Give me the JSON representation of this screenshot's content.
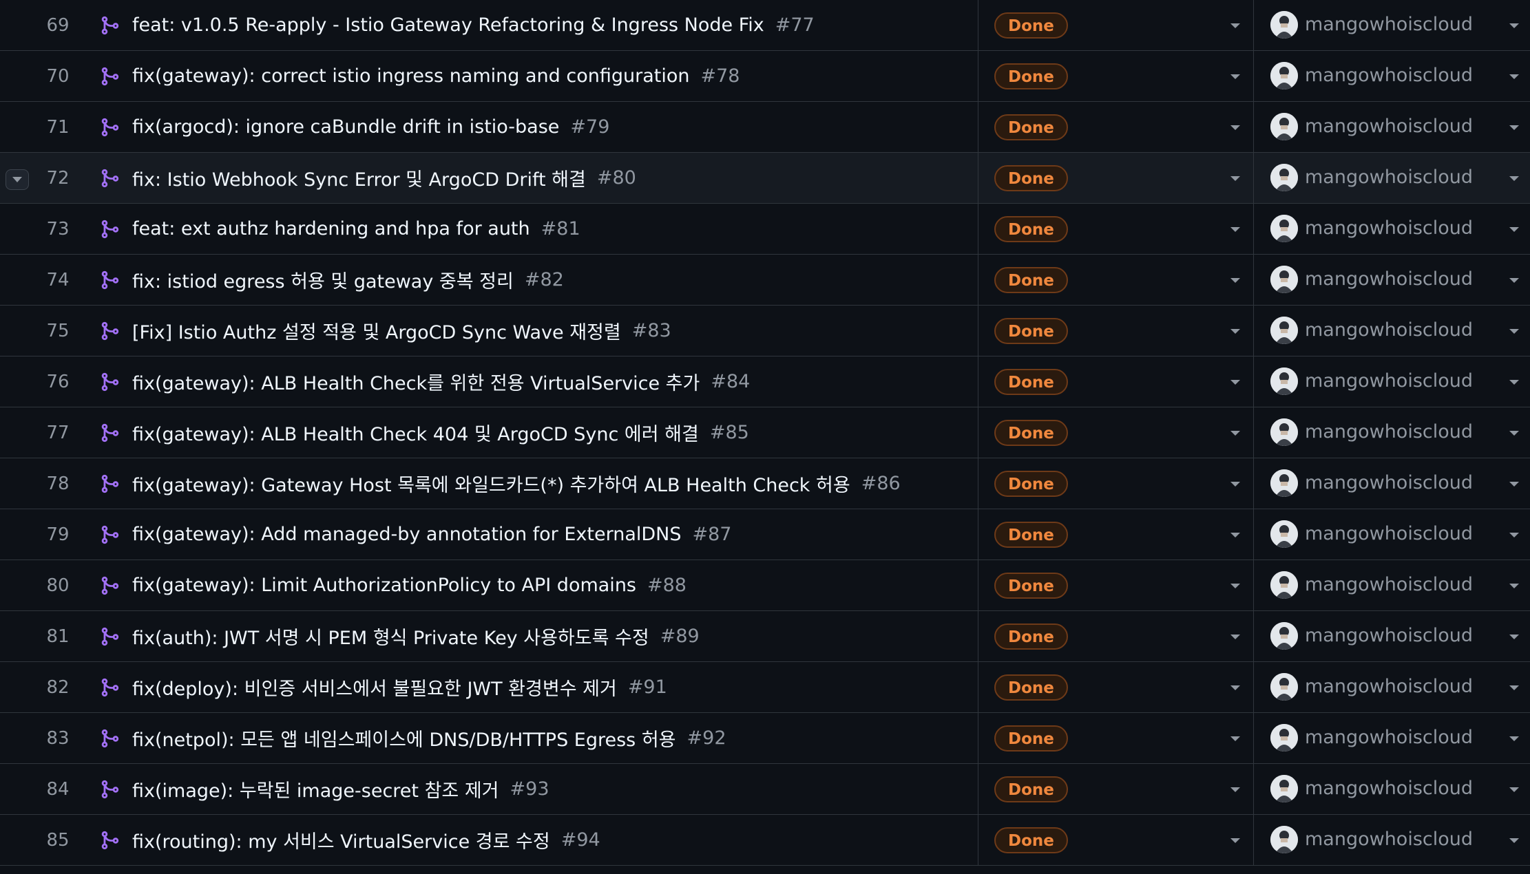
{
  "rows": [
    {
      "num": "69",
      "title": "feat: v1.0.5 Re-apply - Istio Gateway Refactoring & Ingress Node Fix",
      "pr": "#77",
      "status": "Done",
      "assignee": "mangowhoiscloud"
    },
    {
      "num": "70",
      "title": "fix(gateway): correct istio ingress naming and configuration",
      "pr": "#78",
      "status": "Done",
      "assignee": "mangowhoiscloud"
    },
    {
      "num": "71",
      "title": "fix(argocd): ignore caBundle drift in istio-base",
      "pr": "#79",
      "status": "Done",
      "assignee": "mangowhoiscloud"
    },
    {
      "num": "72",
      "title": "fix: Istio Webhook Sync Error 및 ArgoCD Drift 해결",
      "pr": "#80",
      "status": "Done",
      "assignee": "mangowhoiscloud"
    },
    {
      "num": "73",
      "title": "feat: ext authz hardening and hpa for auth",
      "pr": "#81",
      "status": "Done",
      "assignee": "mangowhoiscloud"
    },
    {
      "num": "74",
      "title": "fix: istiod egress 허용 및 gateway 중복 정리",
      "pr": "#82",
      "status": "Done",
      "assignee": "mangowhoiscloud"
    },
    {
      "num": "75",
      "title": "[Fix] Istio Authz 설정 적용 및 ArgoCD Sync Wave 재정렬",
      "pr": "#83",
      "status": "Done",
      "assignee": "mangowhoiscloud"
    },
    {
      "num": "76",
      "title": "fix(gateway): ALB Health Check를 위한 전용 VirtualService 추가",
      "pr": "#84",
      "status": "Done",
      "assignee": "mangowhoiscloud"
    },
    {
      "num": "77",
      "title": "fix(gateway): ALB Health Check 404 및 ArgoCD Sync 에러 해결",
      "pr": "#85",
      "status": "Done",
      "assignee": "mangowhoiscloud"
    },
    {
      "num": "78",
      "title": "fix(gateway): Gateway Host 목록에 와일드카드(*) 추가하여 ALB Health Check 허용",
      "pr": "#86",
      "status": "Done",
      "assignee": "mangowhoiscloud"
    },
    {
      "num": "79",
      "title": "fix(gateway): Add managed-by annotation for ExternalDNS",
      "pr": "#87",
      "status": "Done",
      "assignee": "mangowhoiscloud"
    },
    {
      "num": "80",
      "title": "fix(gateway): Limit AuthorizationPolicy to API domains",
      "pr": "#88",
      "status": "Done",
      "assignee": "mangowhoiscloud"
    },
    {
      "num": "81",
      "title": "fix(auth): JWT 서명 시 PEM 형식 Private Key 사용하도록 수정",
      "pr": "#89",
      "status": "Done",
      "assignee": "mangowhoiscloud"
    },
    {
      "num": "82",
      "title": "fix(deploy): 비인증 서비스에서 불필요한 JWT 환경변수 제거",
      "pr": "#91",
      "status": "Done",
      "assignee": "mangowhoiscloud"
    },
    {
      "num": "83",
      "title": "fix(netpol): 모든 앱 네임스페이스에 DNS/DB/HTTPS Egress 허용",
      "pr": "#92",
      "status": "Done",
      "assignee": "mangowhoiscloud"
    },
    {
      "num": "84",
      "title": "fix(image): 누락된 image-secret 참조 제거",
      "pr": "#93",
      "status": "Done",
      "assignee": "mangowhoiscloud"
    },
    {
      "num": "85",
      "title": "fix(routing): my 서비스 VirtualService 경로 수정",
      "pr": "#94",
      "status": "Done",
      "assignee": "mangowhoiscloud"
    }
  ],
  "icons": {
    "pr": "pull-request-merged-icon",
    "dropdown": "chevron-down-icon"
  },
  "colors": {
    "background": "#0d1117",
    "hover_row": "#161b22",
    "pr_icon": "#a371f7",
    "status_done": "#f0883e"
  }
}
